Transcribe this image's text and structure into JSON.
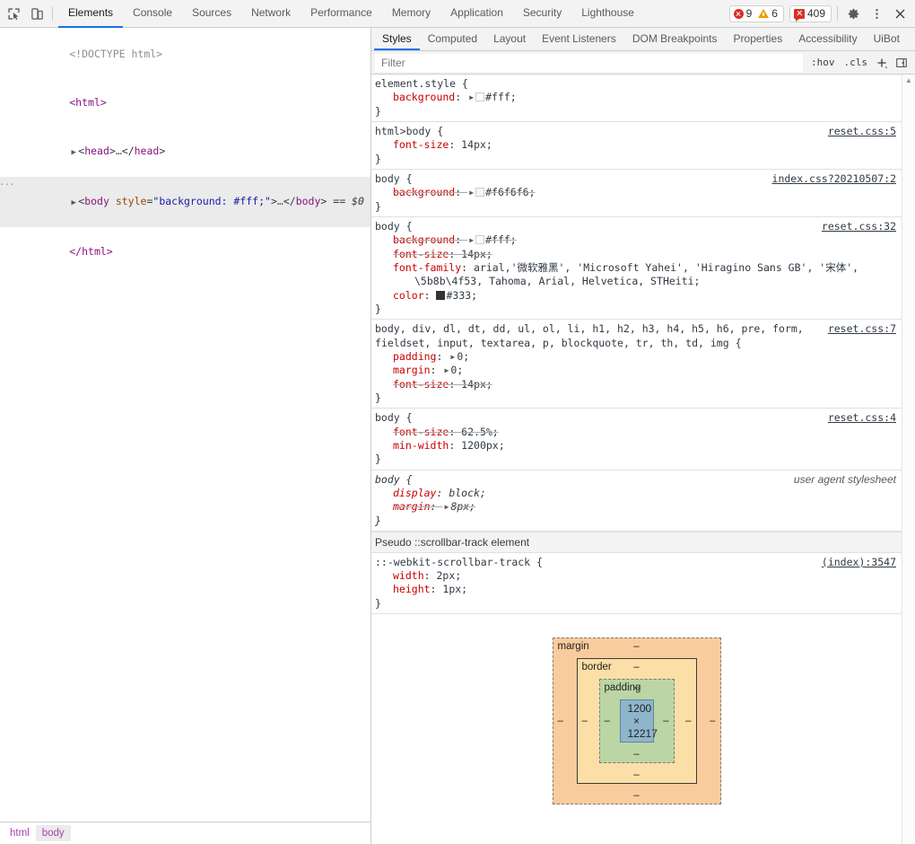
{
  "toolbar": {
    "inspect_icon": "inspect-element-icon",
    "device_icon": "device-toolbar-icon",
    "tabs": [
      {
        "label": "Elements",
        "active": true
      },
      {
        "label": "Console",
        "active": false
      },
      {
        "label": "Sources",
        "active": false
      },
      {
        "label": "Network",
        "active": false
      },
      {
        "label": "Performance",
        "active": false
      },
      {
        "label": "Memory",
        "active": false
      },
      {
        "label": "Application",
        "active": false
      },
      {
        "label": "Security",
        "active": false
      },
      {
        "label": "Lighthouse",
        "active": false
      }
    ],
    "errors_count": "9",
    "warnings_count": "6",
    "messages_count": "409",
    "settings_icon": "gear-icon",
    "more_icon": "kebab-menu-icon",
    "close_icon": "close-icon",
    "accent_color": "#1a73e8",
    "error_color": "#d93025",
    "warning_color": "#f29900"
  },
  "dom": {
    "rows": [
      {
        "type": "doctype",
        "text": "<!DOCTYPE html>"
      },
      {
        "type": "open",
        "text": "<html>"
      },
      {
        "type": "collapsed-head"
      },
      {
        "type": "selected-body"
      },
      {
        "type": "close",
        "text": "</html>"
      }
    ],
    "doctype_text": "<!DOCTYPE html>",
    "html_open": "<html>",
    "head_tag": "head",
    "head_ellipsis": "…",
    "body_tag": "body",
    "body_attr_name": "style",
    "body_attr_value": "\"background: #fff;\"",
    "body_ellipsis": "…",
    "body_suffix": "== $0",
    "html_close": "</html>"
  },
  "breadcrumb": {
    "items": [
      {
        "label": "html",
        "active": false
      },
      {
        "label": "body",
        "active": true
      }
    ]
  },
  "sidebar": {
    "tabs": [
      {
        "label": "Styles",
        "active": true
      },
      {
        "label": "Computed",
        "active": false
      },
      {
        "label": "Layout",
        "active": false
      },
      {
        "label": "Event Listeners",
        "active": false
      },
      {
        "label": "DOM Breakpoints",
        "active": false
      },
      {
        "label": "Properties",
        "active": false
      },
      {
        "label": "Accessibility",
        "active": false
      },
      {
        "label": "UiBot",
        "active": false
      }
    ]
  },
  "filter": {
    "placeholder": "Filter",
    "value": "",
    "hov_label": ":hov",
    "cls_label": ".cls",
    "new_rule_icon": "plus-icon",
    "sidebar_toggle_icon": "toggle-sidebar-icon"
  },
  "styles": {
    "rules": [
      {
        "selector": "element.style {",
        "origin": "",
        "origin_is_ua": false,
        "ua_italic": false,
        "declarations": [
          {
            "name": "background",
            "value": "#fff;",
            "overridden": false,
            "has_expand": true,
            "swatch": "#ffffff"
          }
        ],
        "close": "}"
      },
      {
        "selector": "html>body {",
        "origin": "reset.css:5",
        "origin_is_ua": false,
        "ua_italic": false,
        "declarations": [
          {
            "name": "font-size",
            "value": "14px;",
            "overridden": false,
            "has_expand": false,
            "swatch": ""
          }
        ],
        "close": "}"
      },
      {
        "selector": "body {",
        "origin": "index.css?20210507:2",
        "origin_is_ua": false,
        "ua_italic": false,
        "declarations": [
          {
            "name": "background",
            "value": "#f6f6f6;",
            "overridden": true,
            "has_expand": true,
            "swatch": "#f6f6f6"
          }
        ],
        "close": "}"
      },
      {
        "selector": "body {",
        "origin": "reset.css:32",
        "origin_is_ua": false,
        "ua_italic": false,
        "declarations": [
          {
            "name": "background",
            "value": "#fff;",
            "overridden": true,
            "has_expand": true,
            "swatch": "#ffffff"
          },
          {
            "name": "font-size",
            "value": "14px;",
            "overridden": true,
            "has_expand": false,
            "swatch": ""
          },
          {
            "name": "font-family",
            "value": "arial,'微软雅黑', 'Microsoft Yahei', 'Hiragino Sans GB', '宋体',",
            "value_line2": "\\5b8b\\4f53, Tahoma, Arial, Helvetica, STHeiti;",
            "overridden": false,
            "has_expand": false,
            "swatch": ""
          },
          {
            "name": "color",
            "value": "#333;",
            "overridden": false,
            "has_expand": false,
            "swatch": "#333333"
          }
        ],
        "close": "}"
      },
      {
        "selector": "body, div, dl, dt, dd, ul, ol, li, h1, h2, h3, h4, h5, h6, pre, form,",
        "selector_line2": "fieldset, input, textarea, p, blockquote, tr, th, td, img {",
        "origin": "reset.css:7",
        "origin_is_ua": false,
        "ua_italic": false,
        "declarations": [
          {
            "name": "padding",
            "value": "0;",
            "overridden": false,
            "has_expand": true,
            "swatch": ""
          },
          {
            "name": "margin",
            "value": "0;",
            "overridden": false,
            "has_expand": true,
            "swatch": ""
          },
          {
            "name": "font-size",
            "value": "14px;",
            "overridden": true,
            "has_expand": false,
            "swatch": ""
          }
        ],
        "close": "}"
      },
      {
        "selector": "body {",
        "origin": "reset.css:4",
        "origin_is_ua": false,
        "ua_italic": false,
        "declarations": [
          {
            "name": "font-size",
            "value": "62.5%;",
            "overridden": true,
            "has_expand": false,
            "swatch": ""
          },
          {
            "name": "min-width",
            "value": "1200px;",
            "overridden": false,
            "has_expand": false,
            "swatch": ""
          }
        ],
        "close": "}"
      },
      {
        "selector": "body {",
        "origin": "user agent stylesheet",
        "origin_is_ua": true,
        "ua_italic": true,
        "declarations": [
          {
            "name": "display",
            "value": "block;",
            "overridden": false,
            "has_expand": false,
            "swatch": ""
          },
          {
            "name": "margin",
            "value": "8px;",
            "overridden": true,
            "has_expand": true,
            "swatch": ""
          }
        ],
        "close": "}"
      }
    ],
    "pseudo_header": "Pseudo ::scrollbar-track element",
    "pseudo_rules": [
      {
        "selector": "::-webkit-scrollbar-track {",
        "origin": "(index):3547",
        "origin_is_ua": false,
        "ua_italic": false,
        "declarations": [
          {
            "name": "width",
            "value": "2px;",
            "overridden": false,
            "has_expand": false,
            "swatch": ""
          },
          {
            "name": "height",
            "value": "1px;",
            "overridden": false,
            "has_expand": false,
            "swatch": ""
          }
        ],
        "close": "}"
      }
    ]
  },
  "box_model": {
    "margin_label": "margin",
    "border_label": "border",
    "padding_label": "padding",
    "content_size": "1200 × 12217",
    "dash": "–",
    "margin_top": "–",
    "margin_right": "–",
    "margin_bottom": "–",
    "margin_left": "–",
    "border_top": "–",
    "border_right": "–",
    "border_bottom": "–",
    "border_left": "–",
    "padding_top": "–",
    "padding_right": "–",
    "padding_bottom": "–",
    "padding_left": "–",
    "colors": {
      "margin": "#f9cc9d",
      "border": "#fcdfa6",
      "padding": "#bcd5a4",
      "content": "#8fb5cd"
    }
  },
  "scrollbar": {
    "up_arrow": "▲"
  }
}
